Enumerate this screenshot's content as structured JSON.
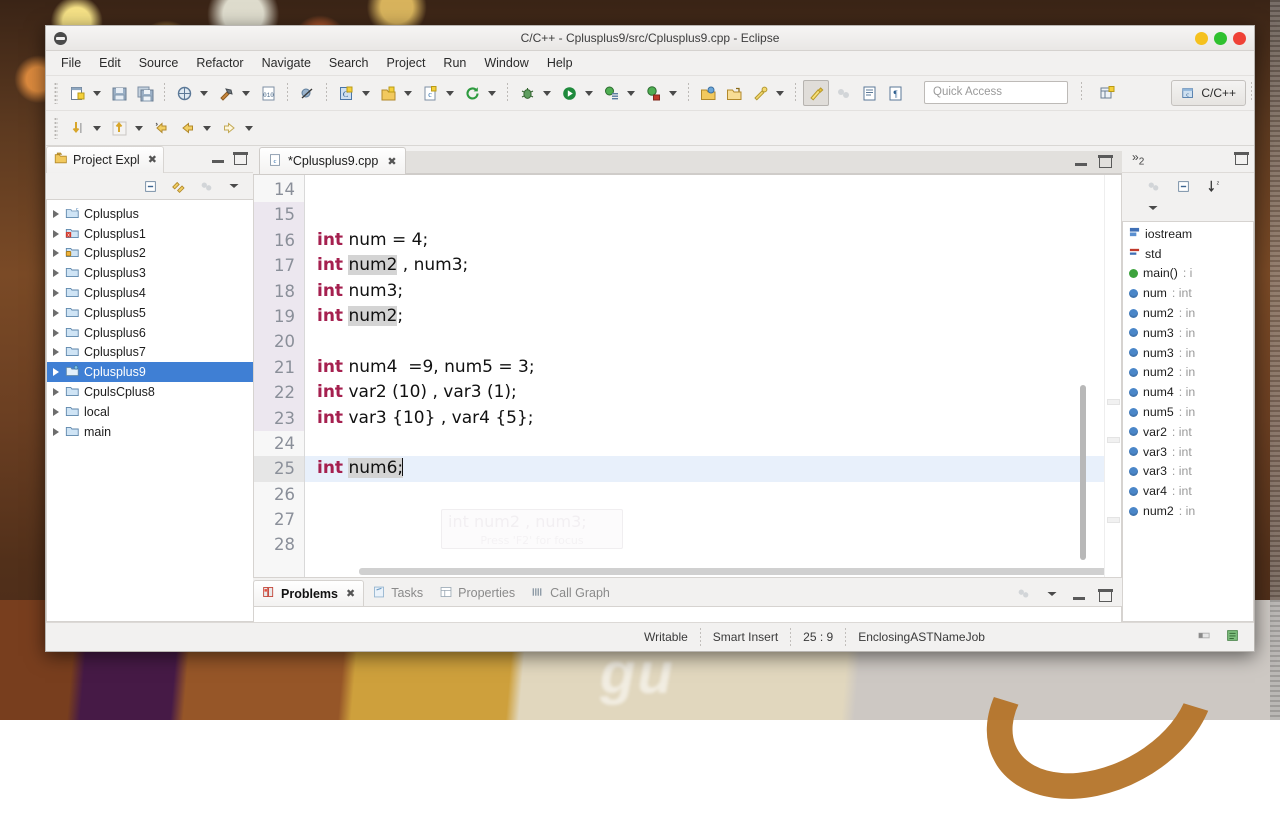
{
  "window": {
    "title": "C/C++ - Cplusplus9/src/Cplusplus9.cpp - Eclipse",
    "app_icon": "eclipse-icon",
    "buttons": {
      "minimize": "minimize",
      "maximize": "maximize",
      "close": "close"
    }
  },
  "menubar": {
    "items": [
      "File",
      "Edit",
      "Source",
      "Refactor",
      "Navigate",
      "Search",
      "Project",
      "Run",
      "Window",
      "Help"
    ]
  },
  "toolbar_top": {
    "quick_access_placeholder": "Quick Access",
    "perspective_label": "C/C++",
    "icons": [
      "new-file-icon",
      "save-icon",
      "save-all-icon",
      "build-all-icon",
      "build-hammer-icon",
      "binary-icon",
      "skip-breakpoints-icon",
      "new-class-icon",
      "new-source-folder-icon",
      "new-c-file-icon",
      "refresh-icon",
      "debug-icon",
      "run-icon",
      "toggle-breakpoint-icon",
      "run-last-tool-icon",
      "open-element-icon",
      "open-type-icon",
      "search-icon",
      "toggle-mark-occurrences-icon",
      "toggle-block-selection-icon",
      "show-whitespace-icon",
      "show-print-margin-icon"
    ]
  },
  "toolbar_second": {
    "icons": [
      "next-annotation-icon",
      "previous-annotation-icon",
      "last-edit-location-icon",
      "back-icon",
      "forward-icon"
    ]
  },
  "project_explorer": {
    "title": "Project Expl",
    "toolbar_icons": [
      "collapse-all-icon",
      "link-with-editor-icon",
      "focus-on-active-task-icon",
      "view-menu-icon"
    ],
    "items": [
      {
        "label": "Cplusplus",
        "icon": "cpp-project-icon",
        "selected": false
      },
      {
        "label": "Cplusplus1",
        "icon": "cpp-project-error-icon",
        "selected": false
      },
      {
        "label": "Cplusplus2",
        "icon": "cpp-project-warning-icon",
        "selected": false
      },
      {
        "label": "Cplusplus3",
        "icon": "cpp-project-icon",
        "selected": false
      },
      {
        "label": "Cplusplus4",
        "icon": "cpp-project-icon",
        "selected": false
      },
      {
        "label": "Cplusplus5",
        "icon": "cpp-project-icon",
        "selected": false
      },
      {
        "label": "Cplusplus6",
        "icon": "cpp-project-icon",
        "selected": false
      },
      {
        "label": "Cplusplus7",
        "icon": "cpp-project-icon",
        "selected": false
      },
      {
        "label": "Cplusplus9",
        "icon": "cpp-project-open-icon",
        "selected": true
      },
      {
        "label": "CpulsCplus8",
        "icon": "cpp-project-icon",
        "selected": false
      },
      {
        "label": "local",
        "icon": "folder-icon",
        "selected": false
      },
      {
        "label": "main",
        "icon": "folder-icon",
        "selected": false
      }
    ]
  },
  "editor": {
    "tab_label": "*Cplusplus9.cpp",
    "tab_icon": "c-source-file-icon",
    "first_visible_line": 14,
    "current_line": 25,
    "ghost_tooltip": {
      "line1": "int num2 , num3;",
      "line2": "Press 'F2' for focus"
    },
    "lines": [
      {
        "n": 14,
        "text": "",
        "highlight": false
      },
      {
        "n": 15,
        "text": "",
        "highlight": true
      },
      {
        "n": 16,
        "text": "int num = 4;",
        "highlight": true
      },
      {
        "n": 17,
        "text": "int num2 , num3;",
        "highlight": true
      },
      {
        "n": 18,
        "text": "int num3;",
        "highlight": true
      },
      {
        "n": 19,
        "text": "int num2;",
        "highlight": true
      },
      {
        "n": 20,
        "text": "",
        "highlight": true
      },
      {
        "n": 21,
        "text": "int num4  =9, num5 = 3;",
        "highlight": true
      },
      {
        "n": 22,
        "text": "int var2 (10) , var3 (1);",
        "highlight": true
      },
      {
        "n": 23,
        "text": "int var3 {10} , var4 {5};",
        "highlight": true
      },
      {
        "n": 24,
        "text": "",
        "highlight": false
      },
      {
        "n": 25,
        "text": "int num6;",
        "highlight": false
      },
      {
        "n": 26,
        "text": "",
        "highlight": false
      },
      {
        "n": 27,
        "text": "",
        "highlight": false
      },
      {
        "n": 28,
        "text": "",
        "highlight": false
      }
    ]
  },
  "outline": {
    "title_icon": "outline-view-icon",
    "toolbar_icons": [
      "focus-on-active-task-icon",
      "collapse-all-icon",
      "sort-icon",
      "view-menu-icon"
    ],
    "items": [
      {
        "label": "iostream",
        "type": "",
        "icon": "include-icon"
      },
      {
        "label": "std",
        "type": "",
        "icon": "using-namespace-icon"
      },
      {
        "label": "main()",
        "type": ": i",
        "icon": "function-icon"
      },
      {
        "label": "num",
        "type": ": int",
        "icon": "variable-icon"
      },
      {
        "label": "num2",
        "type": ": in",
        "icon": "variable-icon"
      },
      {
        "label": "num3",
        "type": ": in",
        "icon": "variable-icon"
      },
      {
        "label": "num3",
        "type": ": in",
        "icon": "variable-icon"
      },
      {
        "label": "num2",
        "type": ": in",
        "icon": "variable-icon"
      },
      {
        "label": "num4",
        "type": ": in",
        "icon": "variable-icon"
      },
      {
        "label": "num5",
        "type": ": in",
        "icon": "variable-icon"
      },
      {
        "label": "var2",
        "type": ": int",
        "icon": "variable-icon"
      },
      {
        "label": "var3",
        "type": ": int",
        "icon": "variable-icon"
      },
      {
        "label": "var3",
        "type": ": int",
        "icon": "variable-icon"
      },
      {
        "label": "var4",
        "type": ": int",
        "icon": "variable-icon"
      },
      {
        "label": "num2",
        "type": ": in",
        "icon": "variable-icon"
      }
    ]
  },
  "bottom_view": {
    "tabs": [
      {
        "label": "Problems",
        "icon": "problems-icon",
        "active": true
      },
      {
        "label": "Tasks",
        "icon": "tasks-icon",
        "active": false
      },
      {
        "label": "Properties",
        "icon": "properties-icon",
        "active": false
      },
      {
        "label": "Call Graph",
        "icon": "call-graph-icon",
        "active": false
      }
    ]
  },
  "statusbar": {
    "writable": "Writable",
    "insert_mode": "Smart Insert",
    "position": "25 : 9",
    "job": "EnclosingASTNameJob"
  },
  "colors": {
    "selection_blue": "#3f7fd4",
    "keyword_magenta": "#a5204f",
    "current_line_blue": "#e8f0fb",
    "occurrence_grey": "#d4d4d4",
    "chrome_grey": "#f2f1f0",
    "close_red": "#ef4136",
    "max_green": "#2fc12f",
    "min_yellow": "#f5c11e"
  },
  "desktop": {
    "wallpaper_text": "gu"
  }
}
